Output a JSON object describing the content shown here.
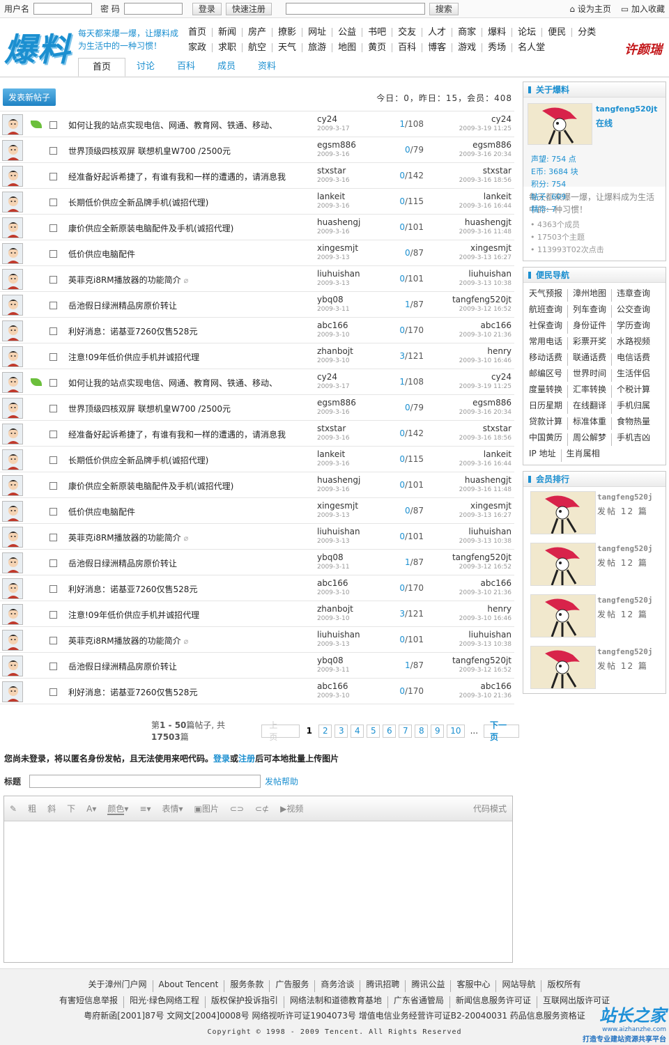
{
  "topbar": {
    "username_label": "用户名",
    "password_label": "密 码",
    "login": "登录",
    "register": "快速注册",
    "search": "搜索",
    "set_home": "设为主页",
    "favorite": "加入收藏"
  },
  "header": {
    "logo": "爆料",
    "slogan": "每天都来爆一爆，让爆料成为生活中的一种习惯！",
    "signature": "许颜瑞",
    "nav_row1": [
      "首页",
      "新闻",
      "房产",
      "撩影",
      "网址",
      "公益",
      "书吧",
      "交友",
      "人才",
      "商家",
      "爆料",
      "论坛",
      "便民",
      "分类"
    ],
    "nav_row2": [
      "家政",
      "求职",
      "航空",
      "天气",
      "旅游",
      "地图",
      "黄页",
      "百科",
      "博客",
      "游戏",
      "秀场",
      "名人堂"
    ],
    "tabs": [
      "首页",
      "讨论",
      "百科",
      "成员",
      "资料"
    ]
  },
  "main": {
    "new_post": "发表新帖子",
    "stats": "今日：0，昨日：15，会员：408",
    "threads": [
      {
        "title": "如何让我的站点实现电信、网通、教育网、铁通、移动、",
        "author": "cy24",
        "date": "2009-3-17",
        "replies": "1",
        "views": "108",
        "last": "cy24",
        "ldate": "2009-3-19 11:25",
        "leaf": true,
        "clip": false
      },
      {
        "title": "世界顶级四核双屏 联想机皇W700 /2500元",
        "author": "egsm886",
        "date": "2009-3-16",
        "replies": "0",
        "views": "79",
        "last": "egsm886",
        "ldate": "2009-3-16 20:34",
        "leaf": false,
        "clip": false
      },
      {
        "title": "经准备好起诉希捷了，有谁有我和一样的遭遇的，请消息我",
        "author": "stxstar",
        "date": "2009-3-16",
        "replies": "0",
        "views": "142",
        "last": "stxstar",
        "ldate": "2009-3-16 18:56",
        "leaf": false,
        "clip": false
      },
      {
        "title": "长期低价供应全新品牌手机(诚招代理)",
        "author": "lankeit",
        "date": "2009-3-16",
        "replies": "0",
        "views": "115",
        "last": "lankeit",
        "ldate": "2009-3-16 16:44",
        "leaf": false,
        "clip": false
      },
      {
        "title": "康价供应全新原装电脑配件及手机(诚招代理)",
        "author": "huashengj",
        "date": "2009-3-16",
        "replies": "0",
        "views": "101",
        "last": "huashengjt",
        "ldate": "2009-3-16 11:48",
        "leaf": false,
        "clip": false
      },
      {
        "title": "低价供应电脑配件",
        "author": "xingesmjt",
        "date": "2009-3-13",
        "replies": "0",
        "views": "87",
        "last": "xingesmjt",
        "ldate": "2009-3-13 16:27",
        "leaf": false,
        "clip": false
      },
      {
        "title": "英菲克i8RM播放器的功能简介",
        "author": "liuhuishan",
        "date": "2009-3-13",
        "replies": "0",
        "views": "101",
        "last": "liuhuishan",
        "ldate": "2009-3-13 10:38",
        "leaf": false,
        "clip": true
      },
      {
        "title": "岳池假日绿洲精品房原价转让",
        "author": "ybq08",
        "date": "2009-3-11",
        "replies": "1",
        "views": "87",
        "last": "tangfeng520jt",
        "ldate": "2009-3-12 16:52",
        "leaf": false,
        "clip": false
      },
      {
        "title": "利好消息：诺基亚7260仅售528元",
        "author": "abc166",
        "date": "2009-3-10",
        "replies": "0",
        "views": "170",
        "last": "abc166",
        "ldate": "2009-3-10 21:36",
        "leaf": false,
        "clip": false
      },
      {
        "title": "注意!09年低价供应手机并诚招代理",
        "author": "zhanbojt",
        "date": "2009-3-10",
        "replies": "3",
        "views": "121",
        "last": "henry",
        "ldate": "2009-3-10 16:46",
        "leaf": false,
        "clip": false
      },
      {
        "title": "如何让我的站点实现电信、网通、教育网、铁通、移动、",
        "author": "cy24",
        "date": "2009-3-17",
        "replies": "1",
        "views": "108",
        "last": "cy24",
        "ldate": "2009-3-19 11:25",
        "leaf": true,
        "clip": false
      },
      {
        "title": "世界顶级四核双屏 联想机皇W700 /2500元",
        "author": "egsm886",
        "date": "2009-3-16",
        "replies": "0",
        "views": "79",
        "last": "egsm886",
        "ldate": "2009-3-16 20:34",
        "leaf": false,
        "clip": false
      },
      {
        "title": "经准备好起诉希捷了，有谁有我和一样的遭遇的，请消息我",
        "author": "stxstar",
        "date": "2009-3-16",
        "replies": "0",
        "views": "142",
        "last": "stxstar",
        "ldate": "2009-3-16 18:56",
        "leaf": false,
        "clip": false
      },
      {
        "title": "长期低价供应全新品牌手机(诚招代理)",
        "author": "lankeit",
        "date": "2009-3-16",
        "replies": "0",
        "views": "115",
        "last": "lankeit",
        "ldate": "2009-3-16 16:44",
        "leaf": false,
        "clip": false
      },
      {
        "title": "康价供应全新原装电脑配件及手机(诚招代理)",
        "author": "huashengj",
        "date": "2009-3-16",
        "replies": "0",
        "views": "101",
        "last": "huashengjt",
        "ldate": "2009-3-16 11:48",
        "leaf": false,
        "clip": false
      },
      {
        "title": "低价供应电脑配件",
        "author": "xingesmjt",
        "date": "2009-3-13",
        "replies": "0",
        "views": "87",
        "last": "xingesmjt",
        "ldate": "2009-3-13 16:27",
        "leaf": false,
        "clip": false
      },
      {
        "title": "英菲克i8RM播放器的功能简介",
        "author": "liuhuishan",
        "date": "2009-3-13",
        "replies": "0",
        "views": "101",
        "last": "liuhuishan",
        "ldate": "2009-3-13 10:38",
        "leaf": false,
        "clip": true
      },
      {
        "title": "岳池假日绿洲精品房原价转让",
        "author": "ybq08",
        "date": "2009-3-11",
        "replies": "1",
        "views": "87",
        "last": "tangfeng520jt",
        "ldate": "2009-3-12 16:52",
        "leaf": false,
        "clip": false
      },
      {
        "title": "利好消息：诺基亚7260仅售528元",
        "author": "abc166",
        "date": "2009-3-10",
        "replies": "0",
        "views": "170",
        "last": "abc166",
        "ldate": "2009-3-10 21:36",
        "leaf": false,
        "clip": false
      },
      {
        "title": "注意!09年低价供应手机并诚招代理",
        "author": "zhanbojt",
        "date": "2009-3-10",
        "replies": "3",
        "views": "121",
        "last": "henry",
        "ldate": "2009-3-10 16:46",
        "leaf": false,
        "clip": false
      },
      {
        "title": "英菲克i8RM播放器的功能简介",
        "author": "liuhuishan",
        "date": "2009-3-13",
        "replies": "0",
        "views": "101",
        "last": "liuhuishan",
        "ldate": "2009-3-13 10:38",
        "leaf": false,
        "clip": true
      },
      {
        "title": "岳池假日绿洲精品房原价转让",
        "author": "ybq08",
        "date": "2009-3-11",
        "replies": "1",
        "views": "87",
        "last": "tangfeng520jt",
        "ldate": "2009-3-12 16:52",
        "leaf": false,
        "clip": false
      },
      {
        "title": "利好消息：诺基亚7260仅售528元",
        "author": "abc166",
        "date": "2009-3-10",
        "replies": "0",
        "views": "170",
        "last": "abc166",
        "ldate": "2009-3-10 21:36",
        "leaf": false,
        "clip": false
      }
    ],
    "pager": {
      "info_prefix": "第",
      "range": "1 - 50",
      "info_mid": "篇帖子, 共",
      "total": "17503",
      "info_suffix": "篇",
      "prev": "上一页",
      "pages": [
        "1",
        "2",
        "3",
        "4",
        "5",
        "6",
        "7",
        "8",
        "9",
        "10"
      ],
      "ellipsis": "...",
      "next": "下一页"
    },
    "notice": {
      "text1": "您尚未登录，将以匿名身份发帖，且无法使用来吧代码。",
      "login": "登录",
      "or": "或",
      "register": "注册",
      "text2": "后可本地批量上传图片"
    },
    "title_label": "标题",
    "help": "发帖帮助",
    "toolbar": [
      "粗",
      "斜",
      "下",
      "颜色",
      "表情",
      "图片",
      "视频"
    ],
    "code_mode": "代码模式"
  },
  "side": {
    "about_title": "关于爆料",
    "user": "tangfeng520jt",
    "online": "在线",
    "stats": [
      "声望: 754 点",
      "E币: 3684 块",
      "积分: 754",
      "帖子: 609",
      "精华: 7"
    ],
    "desc": "每天都来爆一爆，让爆料成为生活中的一种习惯！",
    "counts": [
      "4363个成员",
      "17503个主题",
      "113993T02次点击"
    ],
    "nav_title": "便民导航",
    "nav_rows": [
      [
        "天气预报",
        "漳州地图",
        "违章查询"
      ],
      [
        "航班查询",
        "列车查询",
        "公交查询"
      ],
      [
        "社保查询",
        "身份证件",
        "学历查询"
      ],
      [
        "常用电话",
        "彩票开奖",
        "水路视频"
      ],
      [
        "移动话费",
        "联通话费",
        "电信话费"
      ],
      [
        "邮编区号",
        "世界时间",
        "生活伴侣"
      ],
      [
        "度量转换",
        "汇率转换",
        "个税计算"
      ],
      [
        "日历星期",
        "在线翻译",
        "手机归属"
      ],
      [
        "贷款计算",
        "标准体重",
        "食物热量"
      ],
      [
        "中国黄历",
        "周公解梦",
        "手机吉凶"
      ],
      [
        "IP 地址",
        "生肖属相"
      ]
    ],
    "rank_title": "会员排行",
    "members": [
      {
        "name": "tangfeng520j",
        "posts": "发帖 12 篇"
      },
      {
        "name": "tangfeng520j",
        "posts": "发帖 12 篇"
      },
      {
        "name": "tangfeng520j",
        "posts": "发帖 12 篇"
      },
      {
        "name": "tangfeng520j",
        "posts": "发帖 12 篇"
      }
    ]
  },
  "footer": {
    "row1": [
      "关于漳州门户网",
      "About Tencent",
      "服务条款",
      "广告服务",
      "商务洽谈",
      "腾讯招聘",
      "腾讯公益",
      "客服中心",
      "网站导航",
      "版权所有"
    ],
    "row2": [
      "有害短信息举报",
      "阳光·绿色网络工程",
      "版权保护投诉指引",
      "网络法制和道德教育基地",
      "广东省通管局",
      "新闻信息服务许可证",
      "互联网出版许可证"
    ],
    "row3": "粤府新函[2001]87号 文网文[2004]0008号 网络视听许可证1904073号 增值电信业务经营许可证B2-20040031 药品信息服务资格证",
    "copyright": "Copyright © 1998 - 2009 Tencent. All Rights Reserved",
    "watermark1": "站长之家",
    "watermark2": "打造专业建站资源共享平台",
    "watermark_url": "www.aizhanzhe.com"
  }
}
